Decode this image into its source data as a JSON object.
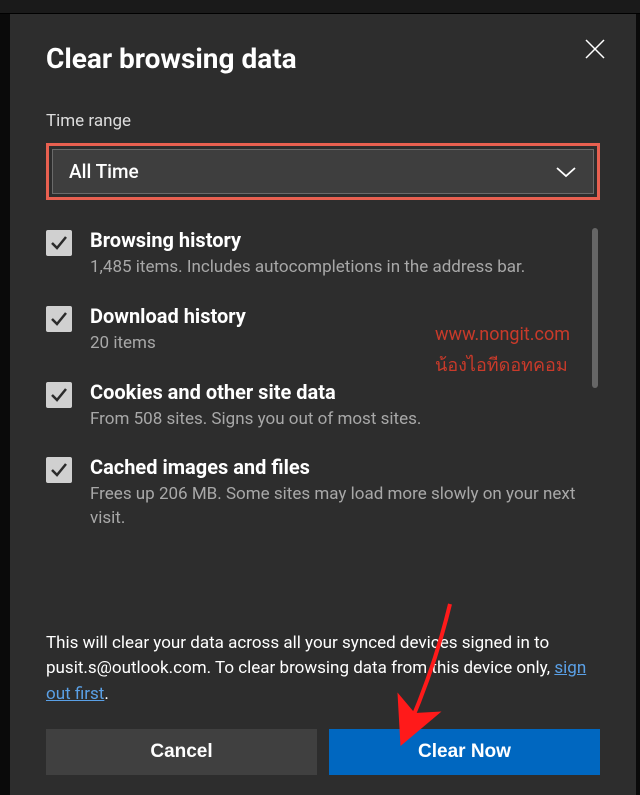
{
  "dialog": {
    "title": "Clear browsing data",
    "time_range_label": "Time range",
    "time_range_value": "All Time"
  },
  "options": [
    {
      "title": "Browsing history",
      "desc": "1,485 items. Includes autocompletions in the address bar.",
      "checked": true
    },
    {
      "title": "Download history",
      "desc": "20 items",
      "checked": true
    },
    {
      "title": "Cookies and other site data",
      "desc": "From 508 sites. Signs you out of most sites.",
      "checked": true
    },
    {
      "title": "Cached images and files",
      "desc": "Frees up 206 MB. Some sites may load more slowly on your next visit.",
      "checked": true
    }
  ],
  "footer": {
    "note_pre": "This will clear your data across all your synced devices signed in to pusit.s@outlook.com. To clear browsing data from this device only, ",
    "link": "sign out first",
    "note_post": "."
  },
  "buttons": {
    "cancel": "Cancel",
    "confirm": "Clear Now"
  },
  "watermark": {
    "line1": "www.nongit.com",
    "line2": "น้องไอทีดอทคอม"
  }
}
